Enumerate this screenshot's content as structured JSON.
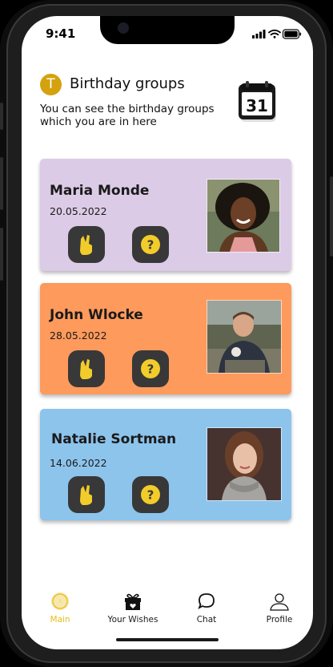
{
  "status_bar": {
    "time": "9:41"
  },
  "header": {
    "avatar_letter": "T",
    "title": "Birthday groups",
    "subtitle": "You can see the birthday groups which you are in here",
    "calendar_day": "31"
  },
  "groups": [
    {
      "name": "Maria Monde",
      "date": "20.05.2022",
      "color": "#dccbe6"
    },
    {
      "name": "John Wlocke",
      "date": "28.05.2022",
      "color": "#fd9a5c"
    },
    {
      "name": "Natalie Sortman",
      "date": "14.06.2022",
      "color": "#8dc4ec"
    }
  ],
  "nav": [
    {
      "label": "Main",
      "icon": "compass-icon",
      "active": true
    },
    {
      "label": "Your Wishes",
      "icon": "gift-icon",
      "active": false
    },
    {
      "label": "Chat",
      "icon": "chat-bubble-icon",
      "active": false
    },
    {
      "label": "Profile",
      "icon": "user-icon",
      "active": false
    }
  ],
  "colors": {
    "accent": "#e8bc1c",
    "button": "#383838"
  }
}
